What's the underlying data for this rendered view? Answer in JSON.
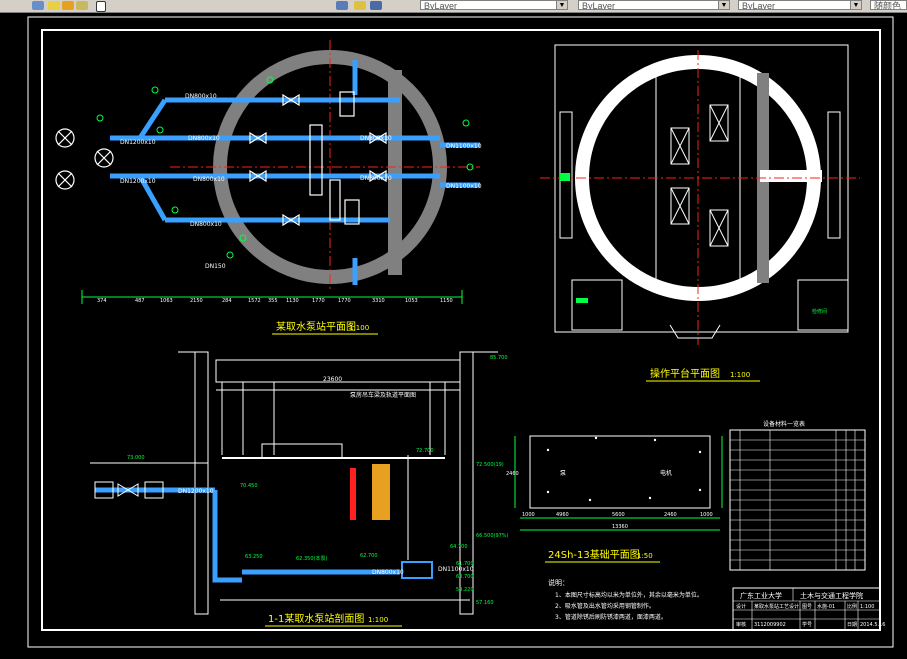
{
  "toolbar": {
    "layer_fields": [
      "ByLayer",
      "ByLayer",
      "ByLayer"
    ],
    "plot_style": "随颜色"
  },
  "colors": {
    "background": "#000000",
    "frame": "#ffffff",
    "pipe": "#3aa0ff",
    "dimension": "#00ff40",
    "centerline": "#ff2020",
    "wall": "#808080",
    "title": "#ffff00",
    "text": "#ffffff"
  },
  "plan": {
    "title": "某取水泵站平面图",
    "scale": "1:100",
    "pipe_labels": [
      "DN1200x10",
      "DN800x10",
      "DN800x10",
      "DN1200x10",
      "DN800x10",
      "DN800x10",
      "DN1100x10",
      "DN1100x10",
      "DN800x10",
      "DN800x10"
    ],
    "dn_note": "DN150",
    "dimensions": [
      "374",
      "487",
      "1063",
      "2150",
      "284",
      "1572",
      "355",
      "1130",
      "1770",
      "1770",
      "3310",
      "1053",
      "1150"
    ]
  },
  "platform": {
    "title": "操作平台平面图",
    "scale": "1:100",
    "label": "检修间"
  },
  "section": {
    "title": "1-1某取水泵站剖面图",
    "scale": "1:100",
    "elevations": [
      "85.700",
      "73.000",
      "72.700",
      "70.450",
      "72.500(19)",
      "66.500(97%)",
      "64.700",
      "63.250",
      "62.350(本泵)",
      "62.700",
      "61.700",
      "60.700",
      "59.220",
      "57.160"
    ],
    "pipe_labels": [
      "DN1200x10",
      "DN800x10",
      "DN1100x10"
    ],
    "span": "23600",
    "note": "泵房吊车梁及轨道平面图"
  },
  "foundation": {
    "title": "24Sh-13基础平面图",
    "scale": "1:50",
    "labels": [
      "泵",
      "电机"
    ],
    "dimensions": [
      "1000",
      "4960",
      "5600",
      "2460",
      "1000",
      "13360",
      "2460"
    ]
  },
  "equipment_table": {
    "title": "设备材料一览表"
  },
  "notes": {
    "heading": "说明：",
    "lines": [
      "1、本图尺寸标高均以米为单位外，其余以毫米为单位。",
      "2、吸水管及出水管均采用钢管制作。",
      "3、管道除锈后刷防锈漆两道，面漆两道。"
    ]
  },
  "title_block": {
    "university": "广东工业大学",
    "school": "土木与交通工程学院",
    "rows": [
      [
        "设计",
        "某取水泵站工艺设计",
        "图号",
        "水施-01",
        "比例",
        "1:100"
      ],
      [
        "审核",
        "学号",
        "3112009902",
        "日期",
        "2014.5.16"
      ]
    ]
  }
}
